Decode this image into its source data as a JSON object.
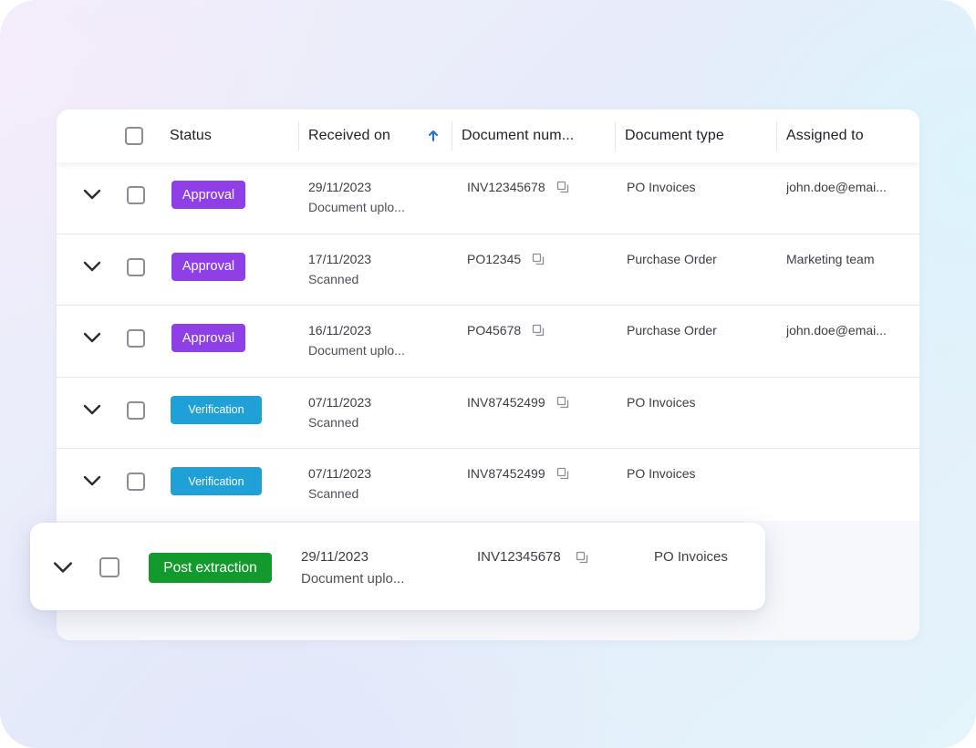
{
  "header": {
    "status": "Status",
    "received_on": "Received on",
    "document_number": "Document num...",
    "document_type": "Document type",
    "assigned_to": "Assigned to"
  },
  "rows": [
    {
      "status": "Approval",
      "date": "29/11/2023",
      "sub": "Document uplo...",
      "doc": "INV12345678",
      "type": "PO Invoices",
      "assigned": "john.doe@emai..."
    },
    {
      "status": "Approval",
      "date": "17/11/2023",
      "sub": "Scanned",
      "doc": "PO12345",
      "type": "Purchase Order",
      "assigned": "Marketing team"
    },
    {
      "status": "Approval",
      "date": "16/11/2023",
      "sub": "Document uplo...",
      "doc": "PO45678",
      "type": "Purchase Order",
      "assigned": "john.doe@emai..."
    },
    {
      "status": "Verification",
      "date": "07/11/2023",
      "sub": "Scanned",
      "doc": "INV87452499",
      "type": "PO Invoices",
      "assigned": ""
    },
    {
      "status": "Verification",
      "date": "07/11/2023",
      "sub": "Scanned",
      "doc": "INV87452499",
      "type": "PO Invoices",
      "assigned": ""
    }
  ],
  "floating_row": {
    "status": "Post extraction",
    "date": "29/11/2023",
    "sub": "Document uplo...",
    "doc": "INV12345678",
    "type": "PO Invoices"
  },
  "colors": {
    "approval": "#8e3fe6",
    "verification": "#1fa0d6",
    "post_extraction": "#139a2c",
    "sort_arrow": "#1e6fd9"
  },
  "icons": {
    "expand": "chevron-down-icon",
    "select": "checkbox-icon",
    "sort": "arrow-up-icon",
    "copy": "copy-icon"
  }
}
